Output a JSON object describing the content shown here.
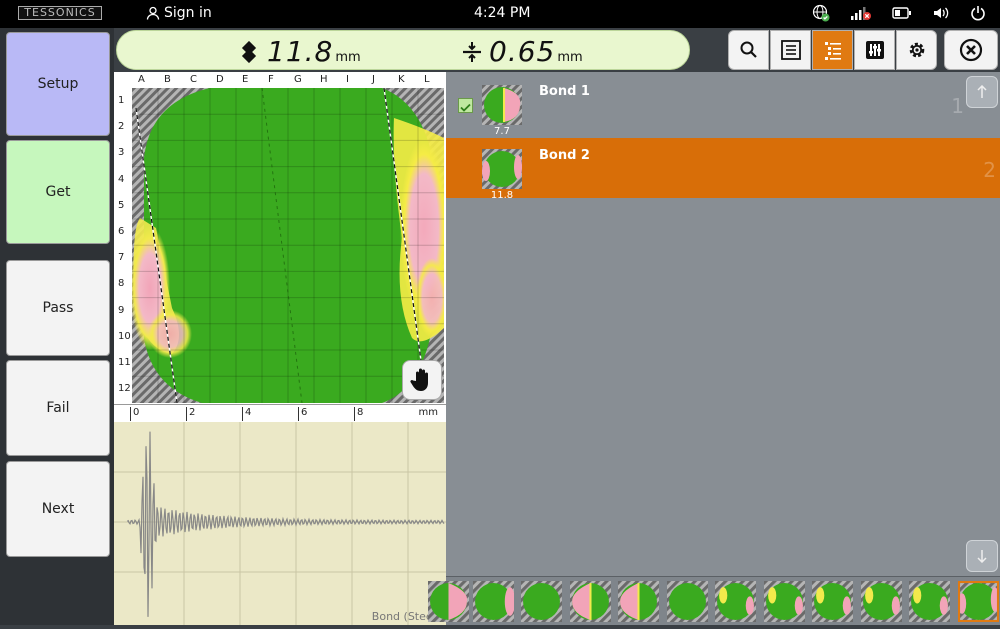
{
  "topbar": {
    "logo": "TESSONICS",
    "signin_label": "Sign in",
    "clock": "4:24 PM",
    "icons": [
      "globe-check-icon",
      "signal-off-icon",
      "battery-icon",
      "volume-icon",
      "power-icon"
    ]
  },
  "nav": {
    "setup": "Setup",
    "get": "Get",
    "pass": "Pass",
    "fail": "Fail",
    "next": "Next"
  },
  "measure": {
    "thickness_value": "11.8",
    "thickness_unit": "mm",
    "indent_value": "0.65",
    "indent_unit": "mm"
  },
  "toolbar": {
    "icons": [
      "search-icon",
      "list-icon",
      "bond-list-icon",
      "adjust-icon",
      "settings-icon"
    ],
    "active_index": 2,
    "close_icon": "close-icon"
  },
  "cscan": {
    "columns": [
      "A",
      "B",
      "C",
      "D",
      "E",
      "F",
      "G",
      "H",
      "I",
      "J",
      "K",
      "L"
    ],
    "rows": [
      "1",
      "2",
      "3",
      "4",
      "5",
      "6",
      "7",
      "8",
      "9",
      "10",
      "11",
      "12"
    ]
  },
  "ruler": {
    "ticks": [
      "0",
      "2",
      "4",
      "6",
      "8"
    ],
    "unit": "mm"
  },
  "ascan": {
    "label": "Bond (Steel)"
  },
  "bonds": [
    {
      "name": "Bond 1",
      "value": "7.7",
      "index": "1",
      "checked": true,
      "selected": false
    },
    {
      "name": "Bond 2",
      "value": "11.8",
      "index": "2",
      "checked": false,
      "selected": true
    }
  ],
  "colors": {
    "accent": "#e07a12",
    "setup": "#b9b9f6",
    "get": "#c6f7bd",
    "measure_bg": "#e9f7cf"
  }
}
